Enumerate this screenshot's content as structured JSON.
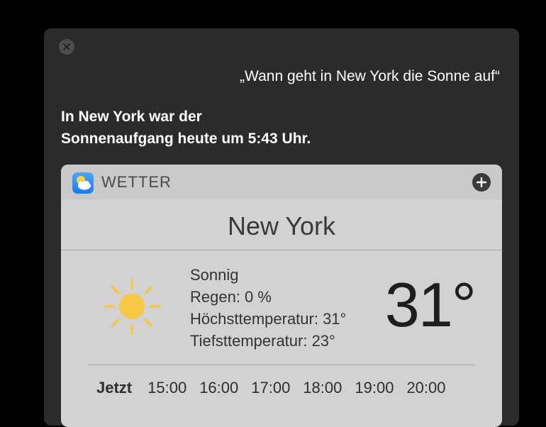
{
  "siri": {
    "query": "„Wann geht in New York die Sonne auf“",
    "answer_line1": "In New York war der",
    "answer_line2": "Sonnenaufgang heute um 5:43 Uhr."
  },
  "weather_card": {
    "app_name": "WETTER",
    "app_icon": "weather-app-icon",
    "add_icon": "plus-circle-icon",
    "city": "New York",
    "condition_icon": "sun-icon",
    "condition": "Sonnig",
    "rain": "Regen: 0 %",
    "high": "Höchsttemperatur: 31°",
    "low": "Tiefsttemperatur: 23°",
    "current_temp": "31°",
    "hours": [
      "Jetzt",
      "15:00",
      "16:00",
      "17:00",
      "18:00",
      "19:00",
      "20:00"
    ]
  },
  "colors": {
    "panel_bg": "#2b2b2b",
    "card_bg": "#d2d2d2",
    "sun": "#f6c843"
  }
}
